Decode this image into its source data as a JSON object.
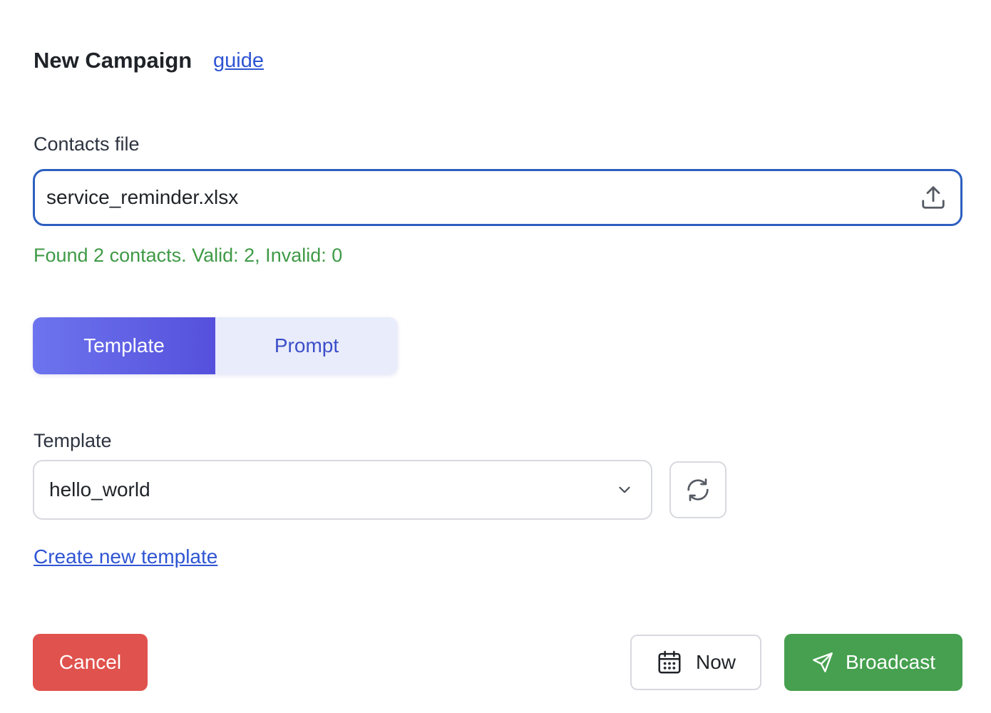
{
  "header": {
    "title": "New Campaign",
    "guide_link": "guide"
  },
  "contacts": {
    "label": "Contacts file",
    "file_name": "service_reminder.xlsx",
    "upload_icon": "upload-icon",
    "status_text": "Found 2 contacts. Valid: 2, Invalid: 0",
    "status_color": "#3f9a46"
  },
  "mode_toggle": {
    "options": [
      "Template",
      "Prompt"
    ],
    "selected": "Template",
    "active_color": "#5e5ee6"
  },
  "template": {
    "label": "Template",
    "selected_value": "hello_world",
    "dropdown_icon": "chevron-down-icon",
    "refresh_icon": "refresh-icon",
    "create_link": "Create new template"
  },
  "footer": {
    "cancel_label": "Cancel",
    "cancel_color": "#e0524d",
    "schedule_label": "Now",
    "schedule_icon": "calendar-icon",
    "broadcast_label": "Broadcast",
    "broadcast_icon": "send-icon",
    "broadcast_color": "#46a04f"
  }
}
